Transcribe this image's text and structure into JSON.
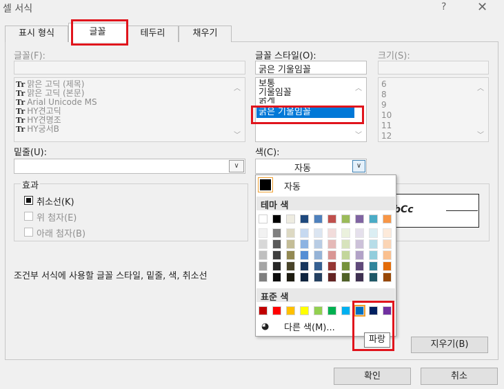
{
  "window": {
    "title": "셀 서식",
    "help": "?",
    "close": "✕"
  },
  "tabs": [
    {
      "label": "표시 형식"
    },
    {
      "label": "글꼴"
    },
    {
      "label": "테두리"
    },
    {
      "label": "채우기"
    }
  ],
  "font": {
    "label": "글꼴(F):",
    "items": [
      "맑은 고딕 (제목)",
      "맑은 고딕 (본문)",
      "Arial Unicode MS",
      "HY견고딕",
      "HY견명조",
      "HY궁서B"
    ]
  },
  "font_style": {
    "label": "글꼴 스타일(O):",
    "value": "굵은 기울임꼴",
    "items": [
      "보통",
      "기울임꼴",
      "굵게",
      "굵은 기울임꼴"
    ]
  },
  "size": {
    "label": "크기(S):",
    "items": [
      "6",
      "8",
      "9",
      "10",
      "11",
      "12"
    ]
  },
  "underline": {
    "label": "밑줄(U):"
  },
  "color": {
    "label": "색(C):",
    "value": "자동"
  },
  "effects": {
    "legend": "효과",
    "strikethrough": "취소선(K)",
    "superscript": "위 첨자(E)",
    "subscript": "아래 첨자(B)",
    "strikethrough_checked": true
  },
  "preview": {
    "sample": "bCc"
  },
  "info_text": "조건부 서식에 사용할 글꼴 스타일, 밑줄, 색, 취소선",
  "buttons": {
    "clear": "지우기(B)",
    "ok": "확인",
    "cancel": "취소"
  },
  "palette": {
    "auto_label": "자동",
    "theme_heading": "테마 색",
    "standard_heading": "표준 색",
    "more_colors": "다른 색(M)...",
    "tooltip": "파랑",
    "theme_rows": [
      [
        "#ffffff",
        "#000000",
        "#e7e6e6",
        "#44546a",
        "#4472c4",
        "#ed7d31",
        "#a5a5a5",
        "#ffc000",
        "#5b9bd5",
        "#70ad47"
      ],
      [
        "#f2f2f2",
        "#7f7f7f",
        "#d0cece",
        "#d6dce4",
        "#d9e2f3",
        "#fbe5d5",
        "#ededed",
        "#fff2cc",
        "#deebf6",
        "#e2efd9"
      ],
      [
        "#d8d8d8",
        "#595959",
        "#aeabab",
        "#adb9ca",
        "#b4c6e7",
        "#f7cbac",
        "#dbdbdb",
        "#fee599",
        "#bdd7ee",
        "#c5e0b3"
      ],
      [
        "#bfbfbf",
        "#3f3f3f",
        "#757070",
        "#8496b0",
        "#8eaadb",
        "#f4b083",
        "#c9c9c9",
        "#ffd965",
        "#9cc3e5",
        "#a8d08d"
      ],
      [
        "#a5a5a5",
        "#262626",
        "#3a3838",
        "#323f4f",
        "#2f5496",
        "#c55a11",
        "#7b7b7b",
        "#bf9000",
        "#2e75b5",
        "#538135"
      ],
      [
        "#7f7f7f",
        "#0c0c0c",
        "#171616",
        "#222a35",
        "#1f3864",
        "#833c0b",
        "#525252",
        "#7f6000",
        "#1e4e79",
        "#375623"
      ]
    ],
    "theme_top_display": [
      "#ffffff",
      "#000000",
      "#eeece1",
      "#1f497d",
      "#4f81bd",
      "#c0504d",
      "#9bbb59",
      "#8064a2",
      "#4bacc6",
      "#f79646"
    ],
    "theme_display": [
      [
        "#f2f2f2",
        "#7f7f7f",
        "#ddd9c3",
        "#c6d9f0",
        "#dbe5f1",
        "#f2dcdb",
        "#ebf1dd",
        "#e5e0ec",
        "#dbeef3",
        "#fdeada"
      ],
      [
        "#d8d8d8",
        "#595959",
        "#c4bd97",
        "#8db3e2",
        "#b8cce4",
        "#e5b9b7",
        "#d7e3bc",
        "#ccc1d9",
        "#b7dde8",
        "#fbd5b5"
      ],
      [
        "#bfbfbf",
        "#3f3f3f",
        "#938953",
        "#548dd4",
        "#95b3d7",
        "#d99694",
        "#c3d69b",
        "#b2a2c7",
        "#92cddc",
        "#fac08f"
      ],
      [
        "#a5a5a5",
        "#262626",
        "#494429",
        "#17365d",
        "#366092",
        "#953734",
        "#76923c",
        "#5f497a",
        "#31859b",
        "#e36c09"
      ],
      [
        "#7f7f7f",
        "#0c0c0c",
        "#1d1b10",
        "#0f243e",
        "#244061",
        "#632423",
        "#4f6128",
        "#3f3151",
        "#205867",
        "#974806"
      ]
    ],
    "standard": [
      "#c00000",
      "#ff0000",
      "#ffc000",
      "#ffff00",
      "#92d050",
      "#00b050",
      "#00b0f0",
      "#0070c0",
      "#002060",
      "#7030a0"
    ]
  }
}
